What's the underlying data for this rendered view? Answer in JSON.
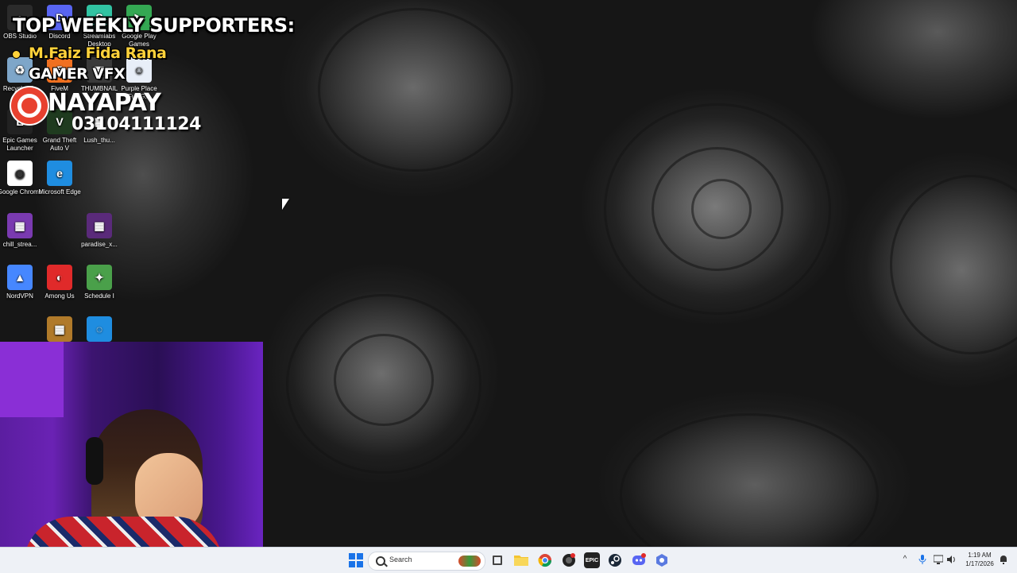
{
  "desktop": {
    "icons": [
      {
        "name": "OBS Studio",
        "color": "#2b2b2b",
        "glyph": "●"
      },
      {
        "name": "Discord",
        "color": "#5865f2",
        "glyph": "D"
      },
      {
        "name": "Streamlabs Desktop",
        "color": "#31c3a2",
        "glyph": "S"
      },
      {
        "name": "Google Play Games",
        "color": "#34a853",
        "glyph": "▶"
      },
      {
        "name": "Recycle Bin",
        "color": "#7ea6c9",
        "glyph": "♻"
      },
      {
        "name": "FiveM",
        "color": "#f07020",
        "glyph": "5"
      },
      {
        "name": "THUMBNAIL",
        "color": "#3a3a3a",
        "glyph": "▦"
      },
      {
        "name": "Purple Place Full G...",
        "color": "#e8eef8",
        "glyph": "☺"
      },
      {
        "name": "Epic Games Launcher",
        "color": "#222222",
        "glyph": "E"
      },
      {
        "name": "Grand Theft Auto V",
        "color": "#1f3b1f",
        "glyph": "V"
      },
      {
        "name": "Lush_thu...",
        "color": "#2a2a2a",
        "glyph": "▦"
      },
      {
        "name": "Google Chrome",
        "color": "#ffffff",
        "glyph": "◉"
      },
      {
        "name": "Microsoft Edge",
        "color": "#1f8de0",
        "glyph": "e"
      },
      {
        "name": "chill_strea...",
        "color": "#7a3ab0",
        "glyph": "▦"
      },
      {
        "name": "paradise_x...",
        "color": "#5a2a7a",
        "glyph": "▦"
      },
      {
        "name": "NordVPN",
        "color": "#4687ff",
        "glyph": "▲"
      },
      {
        "name": "Among Us",
        "color": "#e02a2a",
        "glyph": "◐"
      },
      {
        "name": "Schedule I",
        "color": "#4aa04a",
        "glyph": "✦"
      },
      {
        "name": "",
        "color": "#b07a2a",
        "glyph": "▦"
      },
      {
        "name": "",
        "color": "#1f8de0",
        "glyph": "◌"
      }
    ]
  },
  "overlay": {
    "title": "TOP WEEKLY SUPPORTERS:",
    "supporter_1": "M.Faiz Fida Rana",
    "supporter_2": "GAMER VFX",
    "payment_name": "NAYAPAY",
    "payment_number": "03104111124"
  },
  "taskbar": {
    "search_label": "Search",
    "apps": [
      "start-icon",
      "search-icon",
      "task-view-icon",
      "file-explorer-icon",
      "chrome-icon",
      "obs-icon",
      "epic-games-icon",
      "steam-icon",
      "discord-icon",
      "app-icon"
    ],
    "clock_time": "1:19 AM",
    "clock_date": "1/17/2026"
  }
}
